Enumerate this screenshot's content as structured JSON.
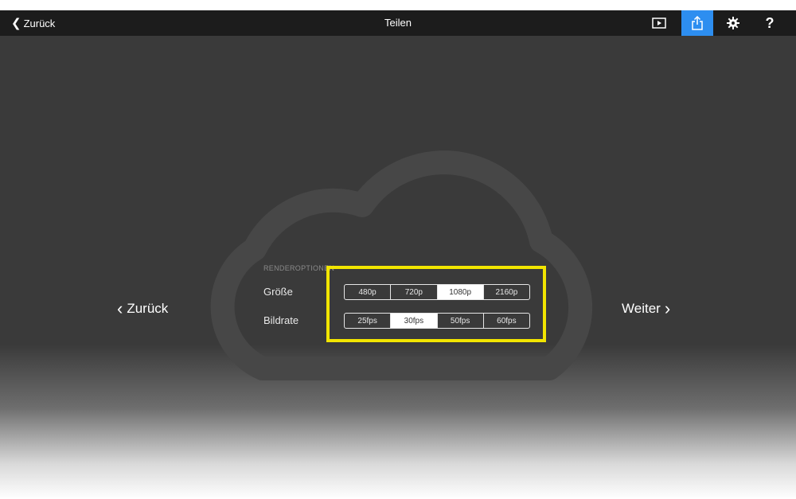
{
  "topbar": {
    "back_label": "Zurück",
    "title": "Teilen",
    "icons": [
      "play-icon",
      "share-icon",
      "gear-icon",
      "help-icon"
    ],
    "help_glyph": "?",
    "accent_color": "#2d8ef0"
  },
  "render": {
    "section_label": "RENDEROPTIONEN",
    "size_label": "Größe",
    "size_options": [
      "480p",
      "720p",
      "1080p",
      "2160p"
    ],
    "size_selected": "1080p",
    "framerate_label": "Bildrate",
    "framerate_options": [
      "25fps",
      "30fps",
      "50fps",
      "60fps"
    ],
    "framerate_selected": "30fps"
  },
  "nav": {
    "back_label": "Zurück",
    "next_label": "Weiter"
  },
  "highlight_color": "#f2e500"
}
